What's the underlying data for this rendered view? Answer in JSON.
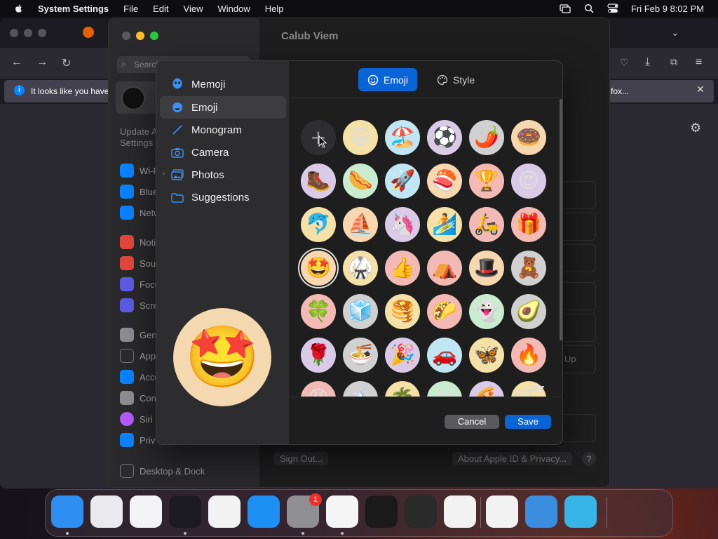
{
  "menubar": {
    "app_name": "System Settings",
    "menus": [
      "File",
      "Edit",
      "View",
      "Window",
      "Help"
    ],
    "clock": "Fri Feb 9  8:02 PM"
  },
  "browser": {
    "banner_text": "It looks like you have",
    "banner_right": "fox..."
  },
  "settings": {
    "title": "Calub Viem",
    "search_placeholder": "Search",
    "update_text": "Update A Settings",
    "sidebar_items": [
      {
        "label": "Wi-F",
        "color": "#0a84ff"
      },
      {
        "label": "Blue",
        "color": "#0a84ff"
      },
      {
        "label": "Netw",
        "color": "#0a84ff"
      },
      {
        "label": "Noti",
        "color": "#e5483d"
      },
      {
        "label": "Sou",
        "color": "#e5483d"
      },
      {
        "label": "Focu",
        "color": "#5e5ce6"
      },
      {
        "label": "Scre",
        "color": "#5e5ce6"
      },
      {
        "label": "Gen",
        "color": "#8e8e93"
      },
      {
        "label": "App",
        "color": "#2c2c2e"
      },
      {
        "label": "Acce",
        "color": "#0a84ff"
      },
      {
        "label": "Con",
        "color": "#8e8e93"
      },
      {
        "label": "Siri",
        "color": "#b65cff"
      },
      {
        "label": "Priv",
        "color": "#0a84ff"
      },
      {
        "label": "Desktop & Dock",
        "color": "#2c2c2e"
      }
    ],
    "up_text": "Up",
    "sign_out": "Sign Out...",
    "about": "About Apple ID & Privacy...",
    "help": "?"
  },
  "dialog": {
    "categories": [
      {
        "label": "Memoji",
        "icon": "memoji-icon"
      },
      {
        "label": "Emoji",
        "icon": "emoji-icon"
      },
      {
        "label": "Monogram",
        "icon": "monogram-icon"
      },
      {
        "label": "Camera",
        "icon": "camera-icon"
      },
      {
        "label": "Photos",
        "icon": "photos-icon"
      },
      {
        "label": "Suggestions",
        "icon": "folder-icon"
      }
    ],
    "selected_category": "Emoji",
    "preview_emoji": "🤩",
    "tabs": {
      "emoji": "Emoji",
      "style": "Style"
    },
    "add_symbol": "+",
    "emojis": [
      {
        "char": "😀",
        "bg": "#f5e0a8"
      },
      {
        "char": "🏖️",
        "bg": "#bfe6f2"
      },
      {
        "char": "⚽",
        "bg": "#d9cbe8"
      },
      {
        "char": "🌶️",
        "bg": "#d0d0d0"
      },
      {
        "char": "🍩",
        "bg": "#f6d7b0"
      },
      {
        "char": "🥾",
        "bg": "#d9cbe8"
      },
      {
        "char": "🌭",
        "bg": "#c9ecd0"
      },
      {
        "char": "🚀",
        "bg": "#bfe6f2"
      },
      {
        "char": "🍣",
        "bg": "#f6d7b0"
      },
      {
        "char": "🏆",
        "bg": "#f3b9b4"
      },
      {
        "char": "😍",
        "bg": "#d9cbe8"
      },
      {
        "char": "🐬",
        "bg": "#f5e0a8"
      },
      {
        "char": "⛵",
        "bg": "#f6d7b0"
      },
      {
        "char": "🦄",
        "bg": "#d9cbe8"
      },
      {
        "char": "🏄",
        "bg": "#f5e0a8"
      },
      {
        "char": "🛵",
        "bg": "#f3b9b4"
      },
      {
        "char": "🎁",
        "bg": "#f3b9b4"
      },
      {
        "char": "🤩",
        "bg": "#f6d7b0"
      },
      {
        "char": "🥋",
        "bg": "#f5e0a8"
      },
      {
        "char": "👍",
        "bg": "#f3b9b4"
      },
      {
        "char": "⛺",
        "bg": "#f3b9b4"
      },
      {
        "char": "🎩",
        "bg": "#f6d7b0"
      },
      {
        "char": "🧸",
        "bg": "#d0d0d0"
      },
      {
        "char": "🍀",
        "bg": "#f3b9b4"
      },
      {
        "char": "🧊",
        "bg": "#d0d0d0"
      },
      {
        "char": "🥞",
        "bg": "#f5e0a8"
      },
      {
        "char": "🌮",
        "bg": "#f3b9b4"
      },
      {
        "char": "👻",
        "bg": "#c9ecd0"
      },
      {
        "char": "🥑",
        "bg": "#d0d0d0"
      },
      {
        "char": "🌹",
        "bg": "#d9cbe8"
      },
      {
        "char": "🍜",
        "bg": "#d0d0d0"
      },
      {
        "char": "🎉",
        "bg": "#d9cbe8"
      },
      {
        "char": "🚗",
        "bg": "#bfe6f2"
      },
      {
        "char": "🦋",
        "bg": "#f5e0a8"
      },
      {
        "char": "🔥",
        "bg": "#f3b9b4"
      },
      {
        "char": "😡",
        "bg": "#f3b9b4"
      },
      {
        "char": "🏔️",
        "bg": "#d0d0d0"
      },
      {
        "char": "🌴",
        "bg": "#f5e0a8"
      },
      {
        "char": "😱",
        "bg": "#c9ecd0"
      },
      {
        "char": "🍕",
        "bg": "#d9cbe8"
      },
      {
        "char": "😴",
        "bg": "#f5e0a8"
      }
    ],
    "cancel": "Cancel",
    "save": "Save"
  },
  "dock": {
    "apps": [
      {
        "name": "finder-icon",
        "bg": "#2f8ff0"
      },
      {
        "name": "launchpad-icon",
        "bg": "#e9e9ee"
      },
      {
        "name": "safari-icon",
        "bg": "#f2f2f7"
      },
      {
        "name": "firefox-icon",
        "bg": "#1c1b22"
      },
      {
        "name": "chrome-icon",
        "bg": "#f2f2f2"
      },
      {
        "name": "app-store-icon",
        "bg": "#1d8ff5"
      },
      {
        "name": "system-settings-icon",
        "bg": "#8e8e93"
      },
      {
        "name": "textedit-icon",
        "bg": "#f5f5f5"
      },
      {
        "name": "terminal-icon",
        "bg": "#1a1a1a"
      },
      {
        "name": "garageband-icon",
        "bg": "#2a2a2a"
      },
      {
        "name": "vscode-icon",
        "bg": "#f2f2f2"
      },
      {
        "name": "visual-studio-icon",
        "bg": "#f2f2f2"
      },
      {
        "name": "weather-icon",
        "bg": "#3b8de0"
      },
      {
        "name": "wordpress-classic-icon",
        "bg": "#38b5e8"
      },
      {
        "name": "trash-icon",
        "bg": "transparent"
      }
    ],
    "badge": "1"
  }
}
